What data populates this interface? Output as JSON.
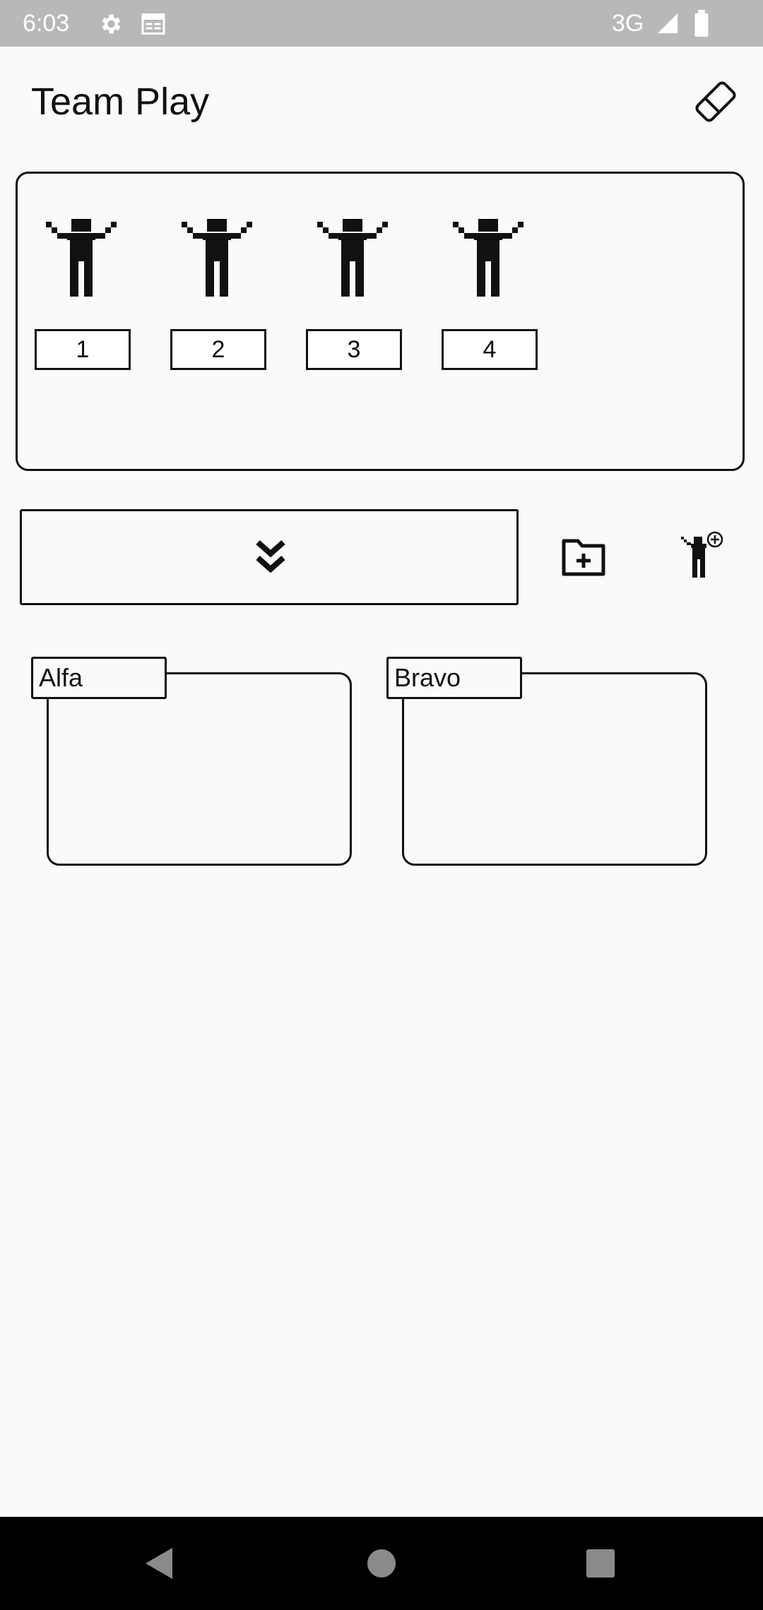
{
  "status_bar": {
    "time": "6:03",
    "network": "3G",
    "icons": [
      "gear-icon",
      "calendar-icon",
      "signal-icon",
      "battery-icon"
    ]
  },
  "header": {
    "title": "Team Play",
    "clear_icon": "eraser-icon"
  },
  "players": [
    {
      "number": "1",
      "icon": "person-arms-up-icon"
    },
    {
      "number": "2",
      "icon": "person-arms-up-icon"
    },
    {
      "number": "3",
      "icon": "person-arms-up-icon"
    },
    {
      "number": "4",
      "icon": "person-arms-up-icon"
    }
  ],
  "toolbar": {
    "dropdown_icon": "double-chevron-down-icon",
    "add_team_icon": "folder-add-icon",
    "add_player_icon": "person-add-icon"
  },
  "teams": [
    {
      "name": "Alfa"
    },
    {
      "name": "Bravo"
    }
  ],
  "nav_bar": {
    "icons": [
      "back-icon",
      "home-icon",
      "recents-icon"
    ]
  },
  "colors": {
    "status_bar": "#b8b8b8",
    "background": "#fafafa",
    "foreground": "#111111",
    "nav_bar": "#000000"
  }
}
